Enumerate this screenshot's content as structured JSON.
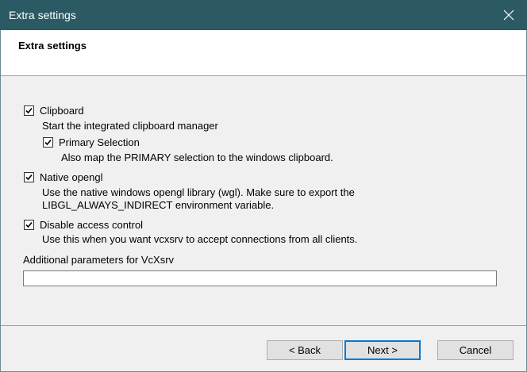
{
  "window": {
    "title": "Extra settings"
  },
  "header": {
    "title": "Extra settings"
  },
  "options": [
    {
      "label": "Clipboard",
      "checked": true,
      "description": [
        "Start the integrated clipboard manager"
      ]
    },
    {
      "label": "Primary Selection",
      "checked": true,
      "description": [
        "Also map the PRIMARY selection to the windows clipboard."
      ]
    },
    {
      "label": "Native opengl",
      "checked": true,
      "description": [
        "Use the native windows opengl library (wgl). Make sure to export the",
        "LIBGL_ALWAYS_INDIRECT environment variable."
      ]
    },
    {
      "label": "Disable access control",
      "checked": true,
      "description": [
        "Use this when you want vcxsrv to accept connections from all clients."
      ]
    }
  ],
  "params": {
    "label": "Additional parameters for VcXsrv",
    "value": ""
  },
  "buttons": {
    "back": "< Back",
    "next": "Next >",
    "cancel": "Cancel"
  },
  "colors": {
    "titlebar": "#2b5a64",
    "default_button_border": "#0078d7"
  },
  "icons": {
    "close": "close-icon",
    "check": "checkmark-icon"
  }
}
